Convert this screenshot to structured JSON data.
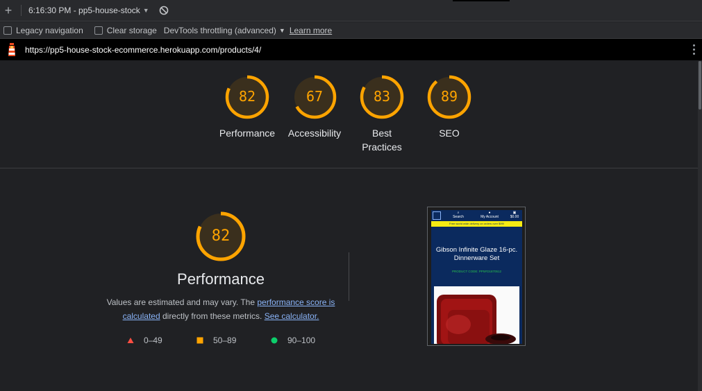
{
  "toolbar": {
    "add_label": "+",
    "report_time": "6:16:30 PM - pp5-house-stock",
    "report_caret": "▼"
  },
  "settings": {
    "legacy_navigation": "Legacy navigation",
    "clear_storage": "Clear storage",
    "throttling": "DevTools throttling (advanced)",
    "throttling_caret": "▼",
    "learn_more": "Learn more"
  },
  "urlbar": {
    "url": "https://pp5-house-stock-ecommerce.herokuapp.com/products/4/"
  },
  "scores": [
    {
      "value": 82,
      "label": "Performance"
    },
    {
      "value": 67,
      "label": "Accessibility"
    },
    {
      "value": 83,
      "label": "Best Practices"
    },
    {
      "value": 89,
      "label": "SEO"
    }
  ],
  "performance": {
    "score": 82,
    "title": "Performance",
    "desc_part1": "Values are estimated and may vary. The ",
    "desc_link1": "performance score is calculated",
    "desc_part2": " directly from these metrics. ",
    "desc_link2": "See calculator."
  },
  "legend": [
    {
      "range": "0–49",
      "shape": "triangle",
      "color": "#ff4e42"
    },
    {
      "range": "50–89",
      "shape": "square",
      "color": "#ffa400"
    },
    {
      "range": "90–100",
      "shape": "circle",
      "color": "#0cce6b"
    }
  ],
  "screenshot": {
    "nav_search": "Search",
    "nav_account": "My Account",
    "nav_cart": "$0.00",
    "banner": "Free world wide delivery on orders over $99!",
    "product_title": "Gibson Infinite Glaze 16-pc. Dinnerware Set",
    "product_code": "PRODUCT CODE: PP5FD1870512"
  },
  "colors": {
    "score_orange": "#ffa400",
    "gauge_bg": "#3a2f1d",
    "link": "#8ab4f8"
  }
}
